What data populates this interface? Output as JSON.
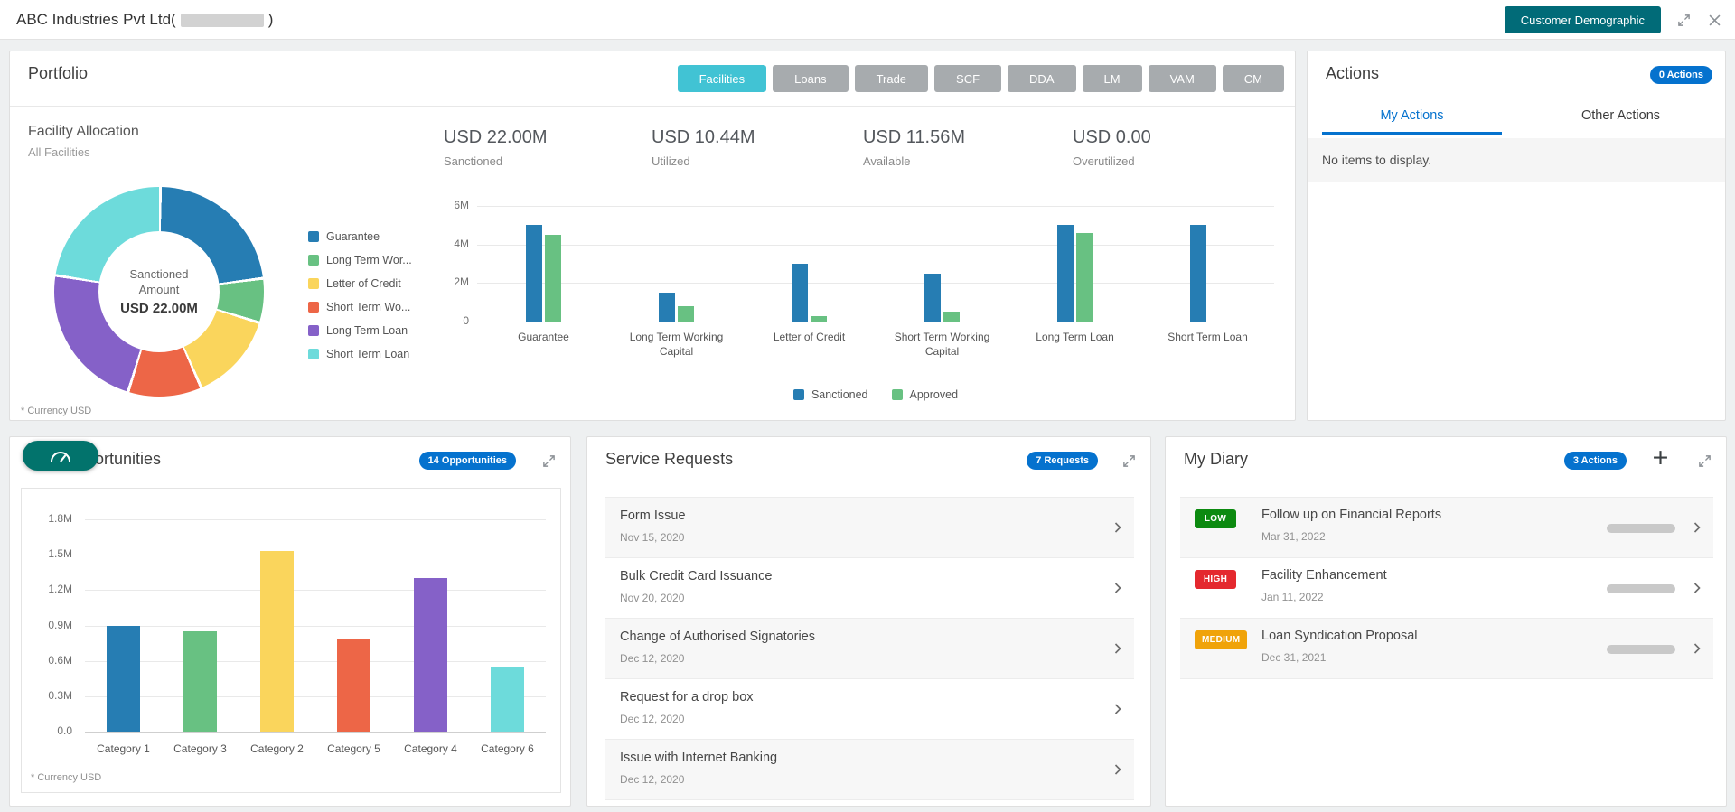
{
  "header": {
    "title_prefix": "ABC Industries Pvt Ltd(",
    "title_suffix": ")",
    "demographic_button_label": "Customer Demographic"
  },
  "portfolio": {
    "title": "Portfolio",
    "tabs": [
      {
        "label": "Facilities",
        "active": true
      },
      {
        "label": "Loans"
      },
      {
        "label": "Trade"
      },
      {
        "label": "SCF"
      },
      {
        "label": "DDA"
      },
      {
        "label": "LM"
      },
      {
        "label": "VAM"
      },
      {
        "label": "CM"
      }
    ],
    "section_title": "Facility Allocation",
    "section_subtitle": "All Facilities",
    "donut_center_label": "Sanctioned Amount",
    "donut_center_value": "USD 22.00M",
    "stats": [
      {
        "value": "USD 22.00M",
        "label": "Sanctioned"
      },
      {
        "value": "USD 10.44M",
        "label": "Utilized"
      },
      {
        "value": "USD 11.56M",
        "label": "Available"
      },
      {
        "value": "USD 0.00",
        "label": "Overutilized"
      }
    ],
    "footnote": "* Currency USD"
  },
  "actions": {
    "title": "Actions",
    "badge": "0 Actions",
    "tabs": [
      {
        "label": "My Actions",
        "active": true
      },
      {
        "label": "Other Actions"
      }
    ],
    "empty_message": "No items to display."
  },
  "opportunities": {
    "title": "Opportunities",
    "badge": "14 Opportunities",
    "footnote": "* Currency USD"
  },
  "service_requests": {
    "title": "Service Requests",
    "badge": "7 Requests",
    "items": [
      {
        "title": "Form Issue",
        "date": "Nov 15, 2020"
      },
      {
        "title": "Bulk Credit Card Issuance",
        "date": "Nov 20, 2020"
      },
      {
        "title": "Change of Authorised Signatories",
        "date": "Dec 12, 2020"
      },
      {
        "title": "Request for a drop box",
        "date": "Dec 12, 2020"
      },
      {
        "title": "Issue with Internet Banking",
        "date": "Dec 12, 2020"
      }
    ]
  },
  "my_diary": {
    "title": "My Diary",
    "badge": "3 Actions",
    "items": [
      {
        "priority": "LOW",
        "priority_color": "#0c8a10",
        "title": "Follow up on Financial Reports",
        "date": "Mar 31, 2022"
      },
      {
        "priority": "HIGH",
        "priority_color": "#e4282e",
        "title": "Facility Enhancement",
        "date": "Jan 11, 2022"
      },
      {
        "priority": "MEDIUM",
        "priority_color": "#f0a30a",
        "title": "Loan Syndication Proposal",
        "date": "Dec 31, 2021"
      }
    ]
  },
  "chart_data": [
    {
      "id": "facility-donut",
      "type": "pie",
      "donut": true,
      "title": "Facility Allocation - All Facilities",
      "center_label": "Sanctioned Amount",
      "center_value": "USD 22.00M",
      "unit": "USD M",
      "slices": [
        {
          "label": "Guarantee",
          "value": 5.0,
          "color": "#267db3"
        },
        {
          "label": "Long Term Wor...",
          "value": 1.5,
          "color": "#68c182"
        },
        {
          "label": "Letter of Credit",
          "value": 3.0,
          "color": "#fad55c"
        },
        {
          "label": "Short Term Wo...",
          "value": 2.5,
          "color": "#ed6647"
        },
        {
          "label": "Long Term Loan",
          "value": 5.0,
          "color": "#8561c8"
        },
        {
          "label": "Short Term Loan",
          "value": 5.0,
          "color": "#6ddbdb"
        }
      ]
    },
    {
      "id": "facility-bars",
      "type": "bar",
      "categories": [
        "Guarantee",
        "Long Term Working Capital",
        "Letter of Credit",
        "Short Term Working Capital",
        "Long Term Loan",
        "Short Term Loan"
      ],
      "series": [
        {
          "name": "Sanctioned",
          "color": "#267db3",
          "values": [
            5.0,
            1.5,
            3.0,
            2.5,
            5.0,
            5.0
          ]
        },
        {
          "name": "Approved",
          "color": "#68c182",
          "values": [
            4.5,
            0.8,
            0.3,
            0.5,
            4.6,
            0
          ]
        }
      ],
      "unit": "USD M",
      "ylim": [
        0,
        6
      ],
      "yticks": [
        {
          "v": 0,
          "label": "0"
        },
        {
          "v": 2,
          "label": "2M"
        },
        {
          "v": 4,
          "label": "4M"
        },
        {
          "v": 6,
          "label": "6M"
        }
      ],
      "grid": true,
      "legend_position": "bottom"
    },
    {
      "id": "opportunities-bars",
      "type": "bar",
      "categories": [
        "Category 1",
        "Category 3",
        "Category 2",
        "Category 5",
        "Category 4",
        "Category 6"
      ],
      "values": [
        0.9,
        0.85,
        1.53,
        0.78,
        1.3,
        0.55
      ],
      "colors": [
        "#267db3",
        "#68c182",
        "#fad55c",
        "#ed6647",
        "#8561c8",
        "#6ddbdb"
      ],
      "unit": "USD M",
      "ylim": [
        0,
        1.8
      ],
      "yticks": [
        {
          "v": 0,
          "label": "0.0"
        },
        {
          "v": 0.3,
          "label": "0.3M"
        },
        {
          "v": 0.6,
          "label": "0.6M"
        },
        {
          "v": 0.9,
          "label": "0.9M"
        },
        {
          "v": 1.2,
          "label": "1.2M"
        },
        {
          "v": 1.5,
          "label": "1.5M"
        },
        {
          "v": 1.8,
          "label": "1.8M"
        }
      ],
      "grid": true
    }
  ]
}
